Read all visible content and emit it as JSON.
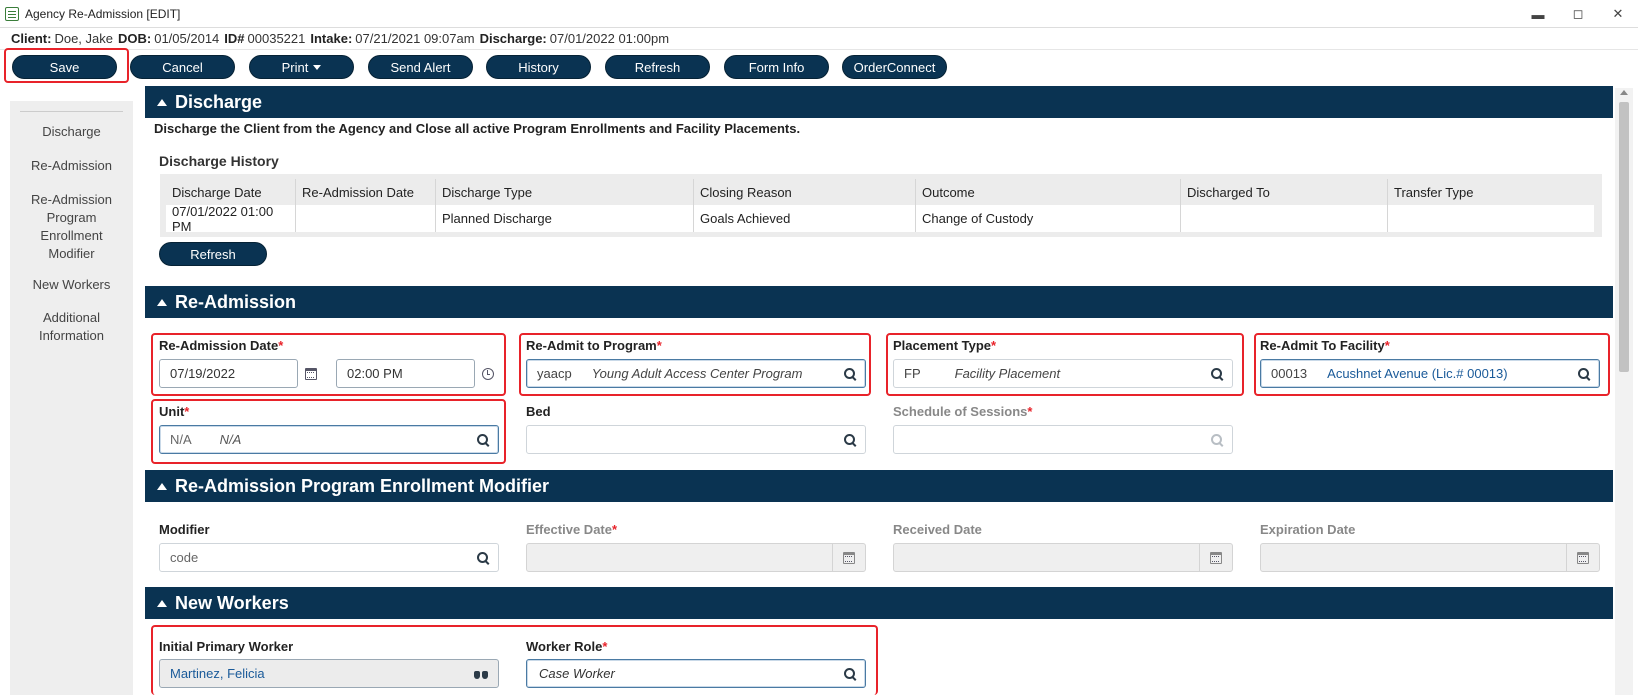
{
  "window": {
    "title": "Agency Re-Admission [EDIT]",
    "controls": {
      "minimize": "▬",
      "maximize": "◻",
      "close": "✕"
    }
  },
  "client": {
    "client_label": "Client:",
    "client_value": "Doe, Jake",
    "dob_label": "DOB:",
    "dob_value": "01/05/2014",
    "id_label": "ID#",
    "id_value": "00035221",
    "intake_label": "Intake:",
    "intake_value": "07/21/2021 09:07am",
    "discharge_label": "Discharge:",
    "discharge_value": "07/01/2022 01:00pm"
  },
  "toolbar": {
    "save": "Save",
    "cancel": "Cancel",
    "print": "Print",
    "send_alert": "Send Alert",
    "history": "History",
    "refresh": "Refresh",
    "form_info": "Form Info",
    "order_connect": "OrderConnect"
  },
  "sidenav": {
    "items": [
      {
        "label": "Discharge"
      },
      {
        "label": "Re-Admission"
      },
      {
        "label": "Re-Admission Program Enrollment Modifier"
      },
      {
        "label": "New Workers"
      },
      {
        "label": "Additional Information"
      }
    ]
  },
  "discharge": {
    "title": "Discharge",
    "description": "Discharge the Client from the Agency and Close all active Program Enrollments and Facility Placements.",
    "history_title": "Discharge History",
    "columns": [
      "Discharge Date",
      "Re-Admission Date",
      "Discharge Type",
      "Closing Reason",
      "Outcome",
      "Discharged To",
      "Transfer Type"
    ],
    "rows": [
      [
        "07/01/2022 01:00 PM",
        "",
        "Planned Discharge",
        "Goals Achieved",
        "Change of Custody",
        "",
        ""
      ]
    ],
    "refresh_label": "Refresh"
  },
  "readmission": {
    "title": "Re-Admission",
    "date_label": "Re-Admission Date",
    "date_value": "07/19/2022",
    "time_value": "02:00 PM",
    "program_label": "Re-Admit to Program",
    "program_code": "yaacp",
    "program_desc": "Young Adult Access Center Program",
    "placement_label": "Placement Type",
    "placement_code": "FP",
    "placement_desc": "Facility Placement",
    "facility_label": "Re-Admit To Facility",
    "facility_code": "00013",
    "facility_desc": "Acushnet Avenue (Lic.# 00013)",
    "unit_label": "Unit",
    "unit_code": "N/A",
    "unit_desc": "N/A",
    "bed_label": "Bed",
    "schedule_label": "Schedule of Sessions",
    "required_mark": "*"
  },
  "modifier": {
    "title": "Re-Admission Program Enrollment Modifier",
    "modifier_label": "Modifier",
    "modifier_placeholder": "code",
    "effective_label": "Effective Date",
    "received_label": "Received Date",
    "expiration_label": "Expiration Date"
  },
  "workers": {
    "title": "New Workers",
    "primary_label": "Initial Primary Worker",
    "primary_value": "Martinez, Felicia",
    "role_label": "Worker Role",
    "role_value": "Case Worker"
  },
  "colors": {
    "header_navy": "#0a3352",
    "highlight_red": "#e8232a",
    "required_red": "#e8232a",
    "link_blue": "#1a5a99"
  }
}
